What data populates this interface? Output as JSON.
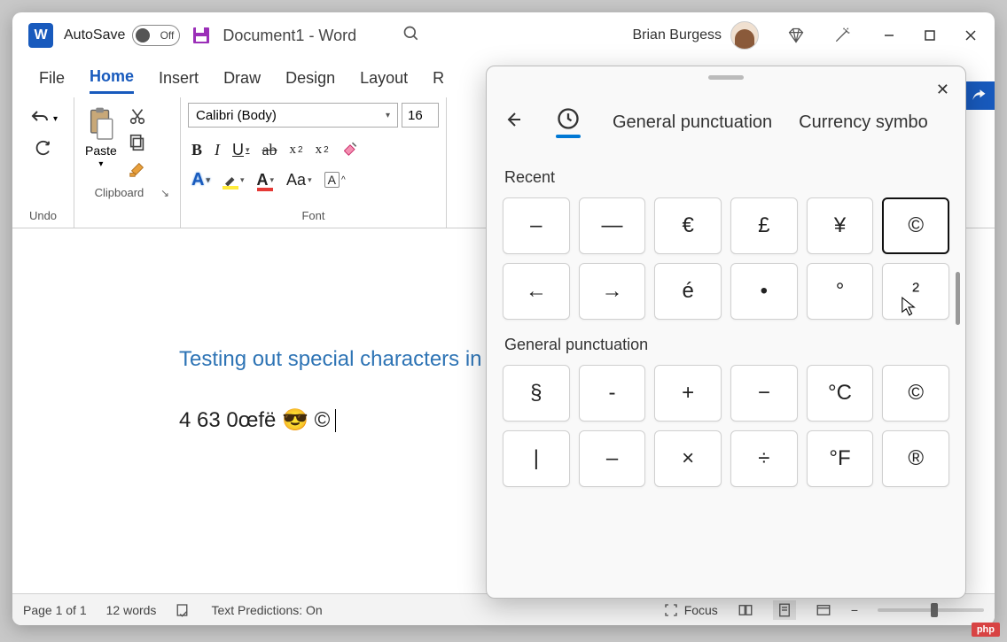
{
  "title": {
    "autosave_label": "AutoSave",
    "autosave_state": "Off",
    "doc_name": "Document1 - Word",
    "user_name": "Brian Burgess"
  },
  "tabs": [
    "File",
    "Home",
    "Insert",
    "Draw",
    "Design",
    "Layout",
    "R"
  ],
  "active_tab": "Home",
  "ribbon": {
    "undo_label": "Undo",
    "clipboard_label": "Clipboard",
    "paste_label": "Paste",
    "font_label": "Font",
    "font_name": "Calibri (Body)",
    "font_size": "16",
    "buttons": {
      "bold": "B",
      "italic": "I",
      "underline": "U",
      "strike": "ab",
      "sub": "x",
      "sup": "x",
      "effects": "A",
      "highlight": "✎",
      "color": "A",
      "case": "Aa",
      "clear": "A"
    }
  },
  "document": {
    "heading": "Testing out special characters in m",
    "line": "4 63   0œfë  😎 ©"
  },
  "statusbar": {
    "page": "Page 1 of 1",
    "words": "12 words",
    "predictions": "Text Predictions: On",
    "focus": "Focus"
  },
  "panel": {
    "tabs": {
      "general": "General punctuation",
      "currency": "Currency symbo"
    },
    "sections": {
      "recent": {
        "label": "Recent",
        "items": [
          "–",
          "—",
          "€",
          "£",
          "¥",
          "©",
          "←",
          "→",
          "é",
          "•",
          "°",
          "²"
        ]
      },
      "general": {
        "label": "General punctuation",
        "items": [
          "§",
          "-",
          "+",
          "−",
          "°C",
          "©",
          "|",
          "–",
          "×",
          "÷",
          "°F",
          "®"
        ]
      }
    },
    "selected_symbol": "©"
  },
  "badge": "php"
}
